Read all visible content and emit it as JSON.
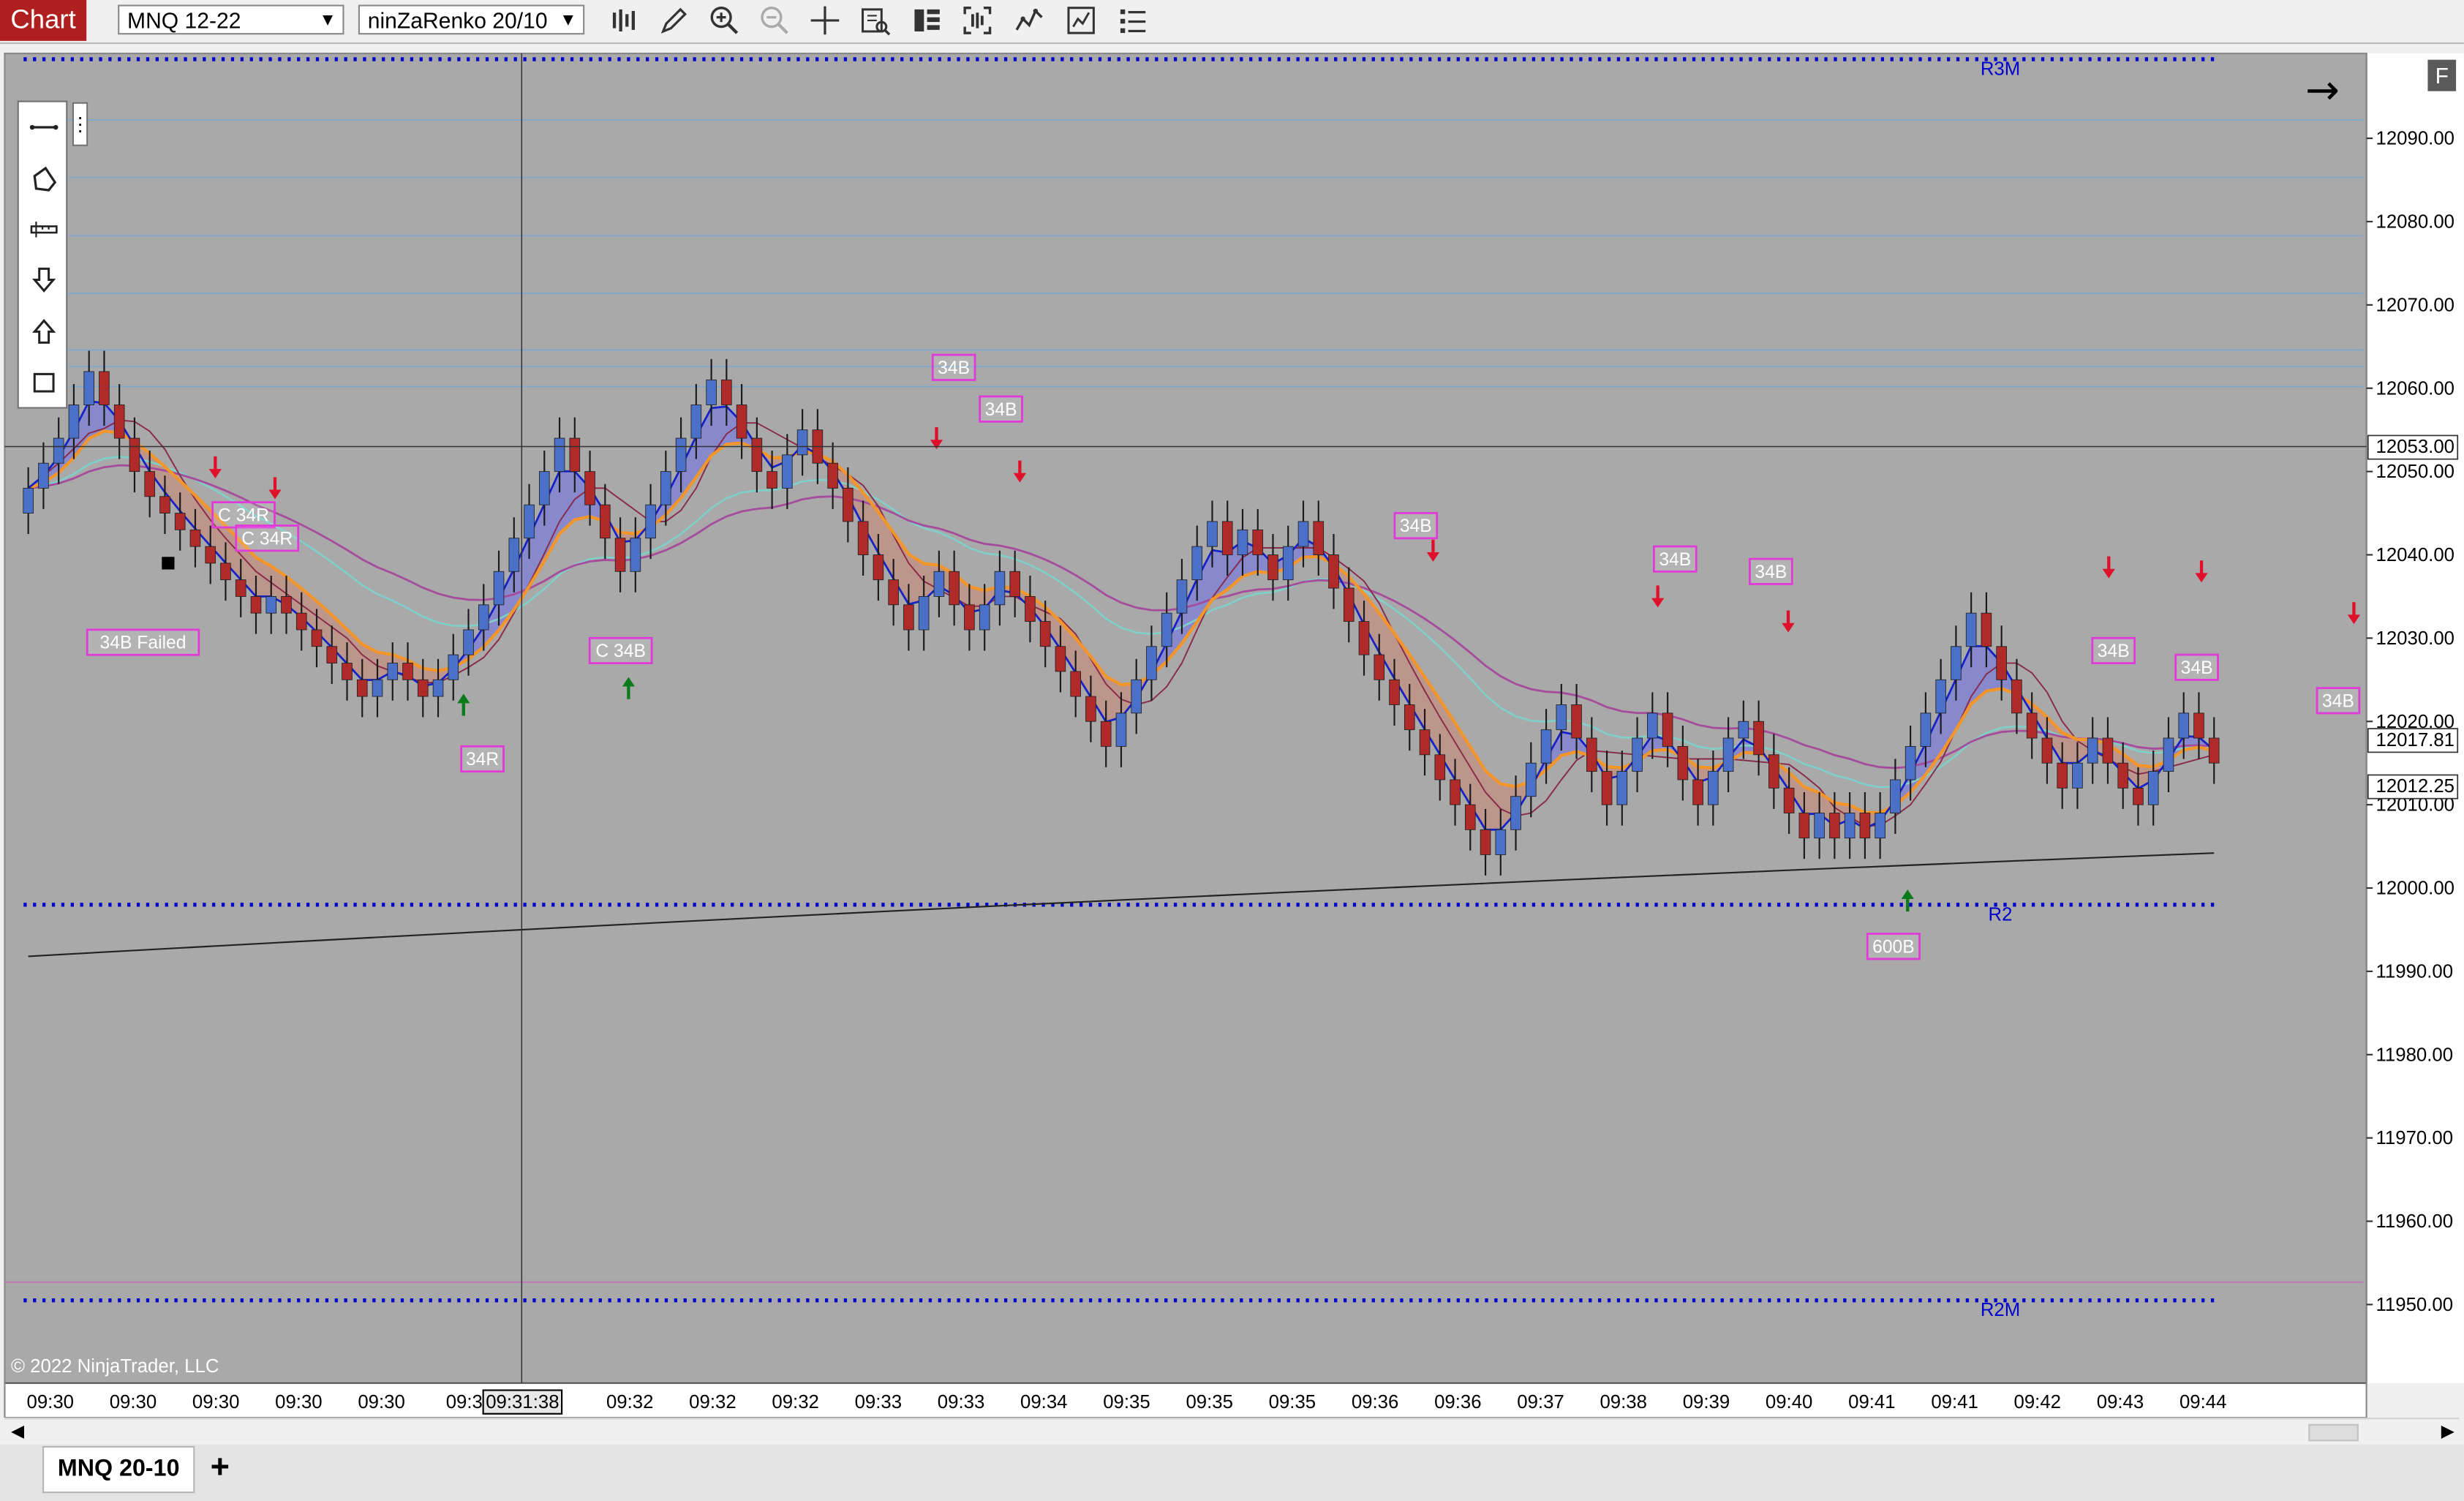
{
  "toolbar": {
    "chart_tab": "Chart",
    "instrument": "MNQ 12-22",
    "bar_type": "ninZaRenko 20/10",
    "icons": [
      "bar-type-icon",
      "drawing-tool-icon",
      "zoom-in-icon",
      "zoom-out-icon",
      "crosshair-icon",
      "data-box-icon",
      "chart-trader-icon",
      "strategies-icon",
      "indicators-icon",
      "properties-icon",
      "templates-icon"
    ]
  },
  "drawing_tools": [
    "line-icon",
    "polygon-icon",
    "ruler-icon",
    "arrow-down-icon",
    "arrow-up-icon",
    "rectangle-icon"
  ],
  "chart_data": {
    "type": "candlestick",
    "instrument": "MNQ 12-22",
    "ylim": [
      11942,
      12103
    ],
    "yticks": [
      "12090.00",
      "12080.00",
      "12070.00",
      "12060.00",
      "12050.00",
      "12040.00",
      "12030.00",
      "12020.00",
      "12010.00",
      "12000.00",
      "11990.00",
      "11980.00",
      "11970.00",
      "11960.00",
      "11950.00"
    ],
    "xticks": [
      "09:30",
      "09:30",
      "09:30",
      "09:30",
      "09:30",
      "09:3",
      "09:31:38",
      "09:32",
      "09:32",
      "09:32",
      "09:33",
      "09:33",
      "09:34",
      "09:35",
      "09:35",
      "09:35",
      "09:36",
      "09:36",
      "09:37",
      "09:38",
      "09:39",
      "09:40",
      "09:41",
      "09:41",
      "09:42",
      "09:43",
      "09:44"
    ],
    "price_labels": [
      {
        "text": "12053.00",
        "price": 12053.0,
        "color": "#ffffff",
        "textcolor": "#000000"
      },
      {
        "text": "12017.81",
        "price": 12017.81,
        "color": "#ffffff",
        "textcolor": "#000000"
      },
      {
        "text": "12012.25",
        "price": 12012.25,
        "color": "#ffffff",
        "textcolor": "#000000"
      }
    ],
    "closes": [
      12048,
      12051,
      12054,
      12058,
      12062,
      12058,
      12054,
      12050,
      12047,
      12045,
      12043,
      12041,
      12039,
      12037,
      12035,
      12033,
      12035,
      12033,
      12031,
      12029,
      12027,
      12025,
      12023,
      12025,
      12027,
      12025,
      12023,
      12025,
      12028,
      12031,
      12034,
      12038,
      12042,
      12046,
      12050,
      12054,
      12050,
      12046,
      12042,
      12038,
      12042,
      12046,
      12050,
      12054,
      12058,
      12061,
      12058,
      12054,
      12050,
      12048,
      12052,
      12055,
      12051,
      12048,
      12044,
      12040,
      12037,
      12034,
      12031,
      12035,
      12038,
      12034,
      12031,
      12034,
      12038,
      12035,
      12032,
      12029,
      12026,
      12023,
      12020,
      12017,
      12021,
      12025,
      12029,
      12033,
      12037,
      12041,
      12044,
      12040,
      12043,
      12040,
      12037,
      12041,
      12044,
      12040,
      12036,
      12032,
      12028,
      12025,
      12022,
      12019,
      12016,
      12013,
      12010,
      12007,
      12004,
      12007,
      12011,
      12015,
      12019,
      12022,
      12018,
      12014,
      12010,
      12014,
      12018,
      12021,
      12017,
      12013,
      12010,
      12014,
      12018,
      12020,
      12016,
      12012,
      12009,
      12006,
      12009,
      12006,
      12009,
      12006,
      12009,
      12013,
      12017,
      12021,
      12025,
      12029,
      12033,
      12029,
      12025,
      12021,
      12018,
      12015,
      12012,
      12015,
      12018,
      12015,
      12012,
      12010,
      12014,
      12018,
      12021,
      12018,
      12015
    ],
    "horizontal_lines": [
      {
        "label": "R3M",
        "price": 12099.5,
        "style": "dotted",
        "color": "#0000cc"
      },
      {
        "label": "R2",
        "price": 11998,
        "style": "dotted",
        "color": "#0000cc"
      },
      {
        "label": "R2M",
        "price": 11950.5,
        "style": "dotted",
        "color": "#0000cc"
      }
    ],
    "signals": [
      {
        "text": "C 34R",
        "x": 155,
        "price": 12044.8
      },
      {
        "text": "C 34R",
        "x": 170,
        "price": 12042
      },
      {
        "text": "34B Failed",
        "x": 91,
        "price": 12029.5
      },
      {
        "text": "C 34B",
        "x": 395,
        "price": 12028.5
      },
      {
        "text": "34R",
        "x": 307,
        "price": 12015.5
      },
      {
        "text": "34B",
        "x": 607,
        "price": 12062.5
      },
      {
        "text": "34B",
        "x": 637,
        "price": 12057.5
      },
      {
        "text": "34B",
        "x": 901,
        "price": 12043.5
      },
      {
        "text": "34B",
        "x": 1066,
        "price": 12039.5
      },
      {
        "text": "34B",
        "x": 1127,
        "price": 12038
      },
      {
        "text": "34B",
        "x": 1345,
        "price": 12028.5
      },
      {
        "text": "34B",
        "x": 1398,
        "price": 12026.5
      },
      {
        "text": "34B",
        "x": 1488,
        "price": 12022.5
      },
      {
        "text": "600B",
        "x": 1205,
        "price": 11993
      }
    ],
    "arrows_down": [
      [
        137,
        12050.5
      ],
      [
        175,
        12048
      ],
      [
        596,
        12054
      ],
      [
        649,
        12050
      ],
      [
        912,
        12040.5
      ],
      [
        1055,
        12035
      ],
      [
        1138,
        12032
      ],
      [
        1342,
        12038.5
      ],
      [
        1401,
        12038
      ],
      [
        1498,
        12033
      ]
    ],
    "arrows_up": [
      [
        295,
        12022
      ],
      [
        400,
        12024
      ],
      [
        1214,
        11998.5
      ]
    ],
    "watermark": "© 2022 NinjaTrader, LLC",
    "crosshair": {
      "time": "09:31:38",
      "price": 12053.0
    }
  },
  "chart_panel": {
    "flag": "F",
    "arrow": "→"
  },
  "bottom_tabs": {
    "active_tab": "MNQ 20-10",
    "add_label": "+"
  }
}
